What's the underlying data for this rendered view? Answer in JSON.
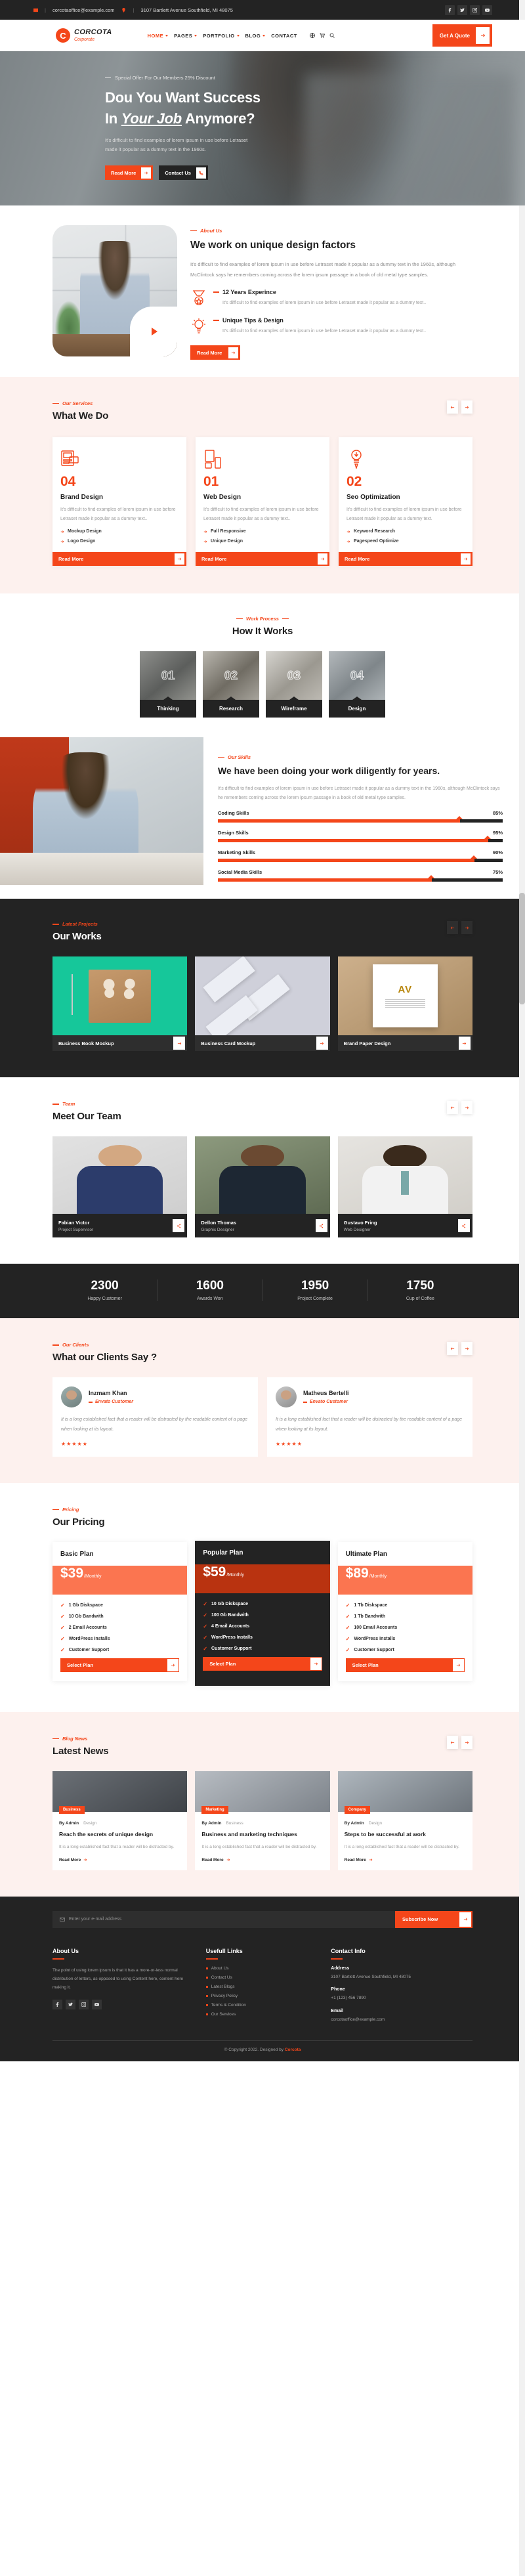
{
  "topbar": {
    "email": "corcotaoffice@example.com",
    "address": "3107 Bartlett Avenue Southfield, MI 48075",
    "sep": "|",
    "socials": [
      "facebook-icon",
      "twitter-icon",
      "instagram-icon",
      "youtube-icon"
    ]
  },
  "nav": {
    "brand_mark": "C",
    "brand_name": "CORCOTA",
    "brand_sub": "Corporate",
    "items": [
      {
        "label": "HOME",
        "has_caret": true,
        "active": true
      },
      {
        "label": "PAGES",
        "has_caret": true,
        "active": false
      },
      {
        "label": "PORTFOLIO",
        "has_caret": true,
        "active": false
      },
      {
        "label": "BLOG",
        "has_caret": true,
        "active": false
      },
      {
        "label": "CONTACT",
        "has_caret": false,
        "active": false
      }
    ],
    "utils": [
      "globe-icon",
      "cart-icon",
      "search-icon"
    ],
    "quote_label": "Get A Quote"
  },
  "hero": {
    "eyebrow": "Special Offer For Our Members 25% Discount",
    "title_line1": "Dou You Want Success",
    "title_line2_pre": "In ",
    "title_line2_em": "Your Job",
    "title_line2_post": " Anymore?",
    "text": "It's difficult to find examples of lorem ipsum in use before Letraset made it popular as a dummy text in the 1960s.",
    "btn_primary": "Read More",
    "btn_secondary": "Contact Us"
  },
  "about": {
    "eyebrow": "About Us",
    "heading": "We work on unique design factors",
    "paragraph": "It's difficult to find examples of lorem ipsum in use before Letraset made it popular as a dummy text in the 1960s, although McClintock says he remembers coming across the lorem ipsum passage in a book of old metal type samples.",
    "features": [
      {
        "icon": "medal-icon",
        "title": "12 Years Experince",
        "text": "It's difficult to find examples of lorem ipsum in use before Letraset made it popular as a dummy text.."
      },
      {
        "icon": "bulb-icon",
        "title": "Unique Tips & Design",
        "text": "It's difficult to find examples of lorem ipsum in use before Letraset made it popular as a dummy text.."
      }
    ],
    "button": "Read More"
  },
  "services": {
    "eyebrow": "Our Services",
    "heading": "What We Do",
    "cards": [
      {
        "icon": "layout-design-icon",
        "number": "04",
        "title": "Brand Design",
        "text": "It's difficult to find examples of lorem ipsum in use before Letraset made it popular as a dummy text..",
        "items": [
          "Mockup Design",
          "Logo Design"
        ],
        "button": "Read More"
      },
      {
        "icon": "devices-icon",
        "number": "01",
        "title": "Web Design",
        "text": "It's difficult to find examples of lorem ipsum in use before Letraset made it popular as a dummy text..",
        "items": [
          "Full Responsive",
          "Unique Design"
        ],
        "button": "Read More"
      },
      {
        "icon": "bulb-pencil-icon",
        "number": "02",
        "title": "Seo Optimization",
        "text": "It's difficult to find examples of lorem ipsum in use before Letraset made it popular as a dummy text.",
        "items": [
          "Keyword Research",
          "Pagespeed Optimize"
        ],
        "button": "Read More"
      }
    ]
  },
  "process": {
    "eyebrow": "Work Process",
    "heading": "How It Works",
    "steps": [
      {
        "number": "01",
        "label": "Thinking"
      },
      {
        "number": "02",
        "label": "Research"
      },
      {
        "number": "03",
        "label": "Wireframe"
      },
      {
        "number": "04",
        "label": "Design"
      }
    ]
  },
  "skills": {
    "eyebrow": "Our Skills",
    "heading": "We have been doing your work diligently for years.",
    "paragraph": "It's difficult to find examples of lorem ipsum in use before Letraset made it popular as a dummy text in the 1960s, although McClintock says he remembers coming across the lorem ipsum passage in a book of old metal type samples.",
    "bars": [
      {
        "label": "Coding Skills",
        "value": "85%",
        "pct": 85
      },
      {
        "label": "Design Skills",
        "value": "95%",
        "pct": 95
      },
      {
        "label": "Marketing Skills",
        "value": "90%",
        "pct": 90
      },
      {
        "label": "Social Media Skills",
        "value": "75%",
        "pct": 75
      }
    ]
  },
  "works": {
    "eyebrow": "Latest Projects",
    "heading": "Our Works",
    "items": [
      {
        "title": "Business Book Mockup"
      },
      {
        "title": "Business Card Mockup"
      },
      {
        "title": "Brand Paper Design"
      }
    ]
  },
  "team": {
    "eyebrow": "Team",
    "heading": "Meet Our Team",
    "members": [
      {
        "name": "Fabian Victor",
        "role": "Project Supervisor"
      },
      {
        "name": "Dellon Thomas",
        "role": "Graphic Designer"
      },
      {
        "name": "Gustavo Fring",
        "role": "Web Designer"
      }
    ]
  },
  "counters": [
    {
      "number": "2300",
      "label": "Happy Customer"
    },
    {
      "number": "1600",
      "label": "Awards Won"
    },
    {
      "number": "1950",
      "label": "Project Complete"
    },
    {
      "number": "1750",
      "label": "Cup of Coffee"
    }
  ],
  "testimonials": {
    "eyebrow": "Our Clients",
    "heading": "What our Clients Say ?",
    "items": [
      {
        "name": "Inzmam Khan",
        "role": "Envato Customer",
        "text": "It is a long established fact that a reader will be distracted by the readable content of a page when looking at its layout.",
        "stars": "★★★★★"
      },
      {
        "name": "Matheus Bertelli",
        "role": "Envato Customer",
        "text": "It is a long established fact that a reader will be distracted by the readable content of a page when looking at its layout.",
        "stars": "★★★★★"
      }
    ]
  },
  "pricing": {
    "eyebrow": "Pricing",
    "heading": "Our Pricing",
    "plans": [
      {
        "name": "Basic Plan",
        "amount": "$39",
        "per": "/Monthly",
        "popular": false,
        "features": [
          "1 Gb Diskspace",
          "10 Gb Bandwith",
          "2 Email Accounts",
          "WordPress Installs",
          "Customer Support"
        ],
        "button": "Select Plan"
      },
      {
        "name": "Popular Plan",
        "amount": "$59",
        "per": "/Monthly",
        "popular": true,
        "features": [
          "10 Gb Diskspace",
          "100 Gb Bandwith",
          "4 Email Accounts",
          "WordPress Installs",
          "Customer Support"
        ],
        "button": "Select Plan"
      },
      {
        "name": "Ultimate Plan",
        "amount": "$89",
        "per": "/Monthly",
        "popular": false,
        "features": [
          "1 Tb Diskspace",
          "1 Tb Bandwith",
          "100 Email Accounts",
          "WordPress Installs",
          "Customer Support"
        ],
        "button": "Select Plan"
      }
    ]
  },
  "blog": {
    "eyebrow": "Blog News",
    "heading": "Latest News",
    "posts": [
      {
        "tag": "Business",
        "author": "By Admin",
        "category": "Design",
        "title": "Reach the secrets of unique design",
        "text": "It is a long established fact that a reader will be distracted by.",
        "more": "Read More"
      },
      {
        "tag": "Marketing",
        "author": "By Admin",
        "category": "Business",
        "title": "Business and marketing techniques",
        "text": "It is a long established fact that a reader will be distracted by.",
        "more": "Read More"
      },
      {
        "tag": "Company",
        "author": "By Admin",
        "category": "Design",
        "title": "Steps to be successful at work",
        "text": "It is a long established fact that a reader will be distracted by.",
        "more": "Read More"
      }
    ]
  },
  "newsletter": {
    "placeholder": "Enter your e-mail address",
    "button": "Subscribe Now"
  },
  "footer": {
    "about_title": "About Us",
    "about_text": "The point of using lorem ipsum is that it has a more-or-less normal distribution of letters, as opposed to using Content here, content here making it.",
    "links_title": "Usefull Links",
    "links": [
      "About Us",
      "Contact Us",
      "Latest Blogs",
      "Privacy Policy",
      "Terms & Condition",
      "Our Services"
    ],
    "contact_title": "Contact Info",
    "contact": [
      {
        "label": "Address",
        "value": "3107 Bartlett Avenue Southfield, MI 48075"
      },
      {
        "label": "Phone",
        "value": "+1 (123) 456 7890"
      },
      {
        "label": "Email",
        "value": "corcotaoffice@example.com"
      }
    ],
    "socials": [
      "facebook-icon",
      "twitter-icon",
      "instagram-icon",
      "youtube-icon"
    ],
    "copyright_pre": "© Copyright 2022. Designed by ",
    "copyright_brand": "Corcota"
  },
  "colors": {
    "accent": "#f4461a",
    "dark": "#232323",
    "soft_bg": "#fdf1ee",
    "accent_light": "#fb7550"
  }
}
